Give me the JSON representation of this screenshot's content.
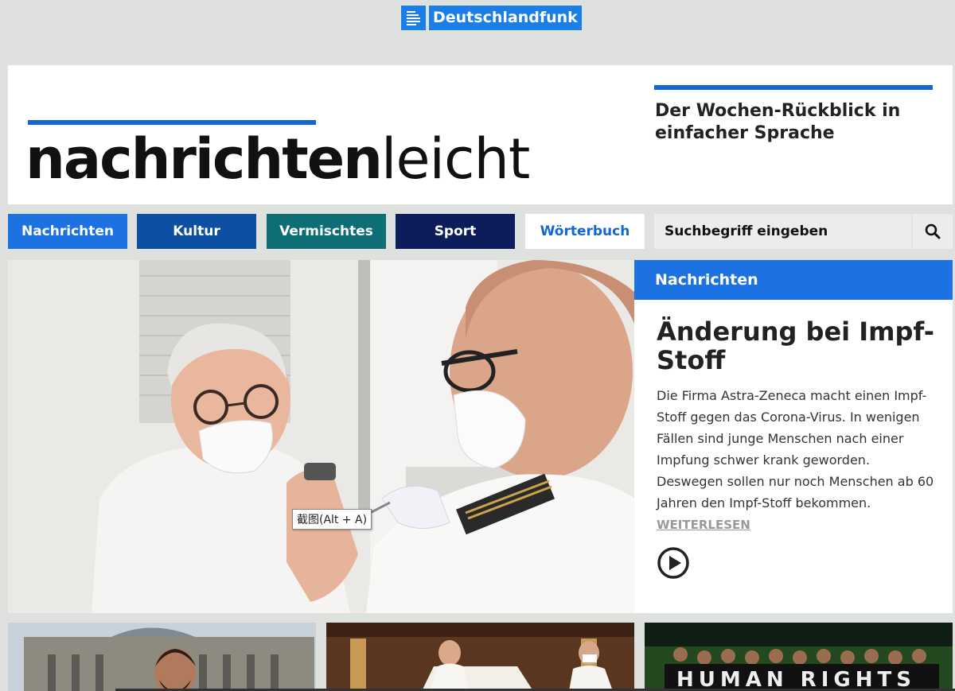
{
  "brand": {
    "name": "Deutschlandfunk"
  },
  "header": {
    "logo_bold": "nachrichten",
    "logo_light": "leicht",
    "tagline": "Der Wochen-Rückblick in einfacher Sprache"
  },
  "nav": {
    "items": [
      {
        "label": "Nachrichten",
        "color": "#1b72e0"
      },
      {
        "label": "Kultur",
        "color": "#0d4fa3"
      },
      {
        "label": "Vermischtes",
        "color": "#0d6e75"
      },
      {
        "label": "Sport",
        "color": "#0d1d5c"
      },
      {
        "label": "Wörterbuch",
        "color": "#ffffff"
      }
    ],
    "search_placeholder": "Suchbegriff eingeben",
    "search_icon": "search-icon"
  },
  "hero": {
    "tooltip": "截图(Alt + A)",
    "category": "Nachrichten",
    "title": "Änderung bei Impf-Stoff",
    "body": "Die Firma Astra-Zeneca macht einen Impf-Stoff gegen das Corona-Virus. In wenigen Fällen sind junge Menschen nach einer Impfung schwer krank geworden. Deswegen sollen nur noch Menschen ab 60 Jahren den Impf-Stoff bekommen.",
    "more_label": "WEITERLESEN",
    "play_icon": "play-icon"
  },
  "thumbs": [
    {
      "name": "reichstag-thumb"
    },
    {
      "name": "pope-thumb"
    },
    {
      "name": "human-rights-thumb",
      "caption": "HUMAN RIGHTS"
    }
  ]
}
